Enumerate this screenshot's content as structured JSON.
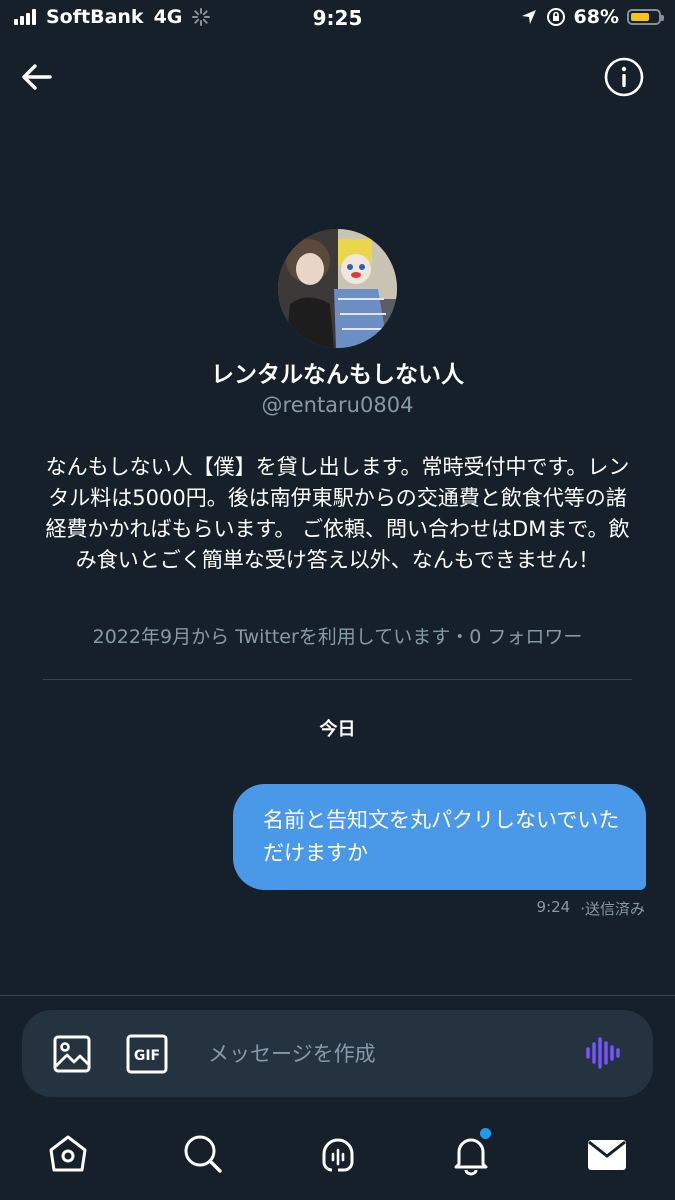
{
  "status_bar": {
    "carrier": "SoftBank",
    "network": "4G",
    "time": "9:25",
    "battery": "68%",
    "battery_level": 0.68
  },
  "header": {
    "back_icon": "back-arrow-icon",
    "info_icon": "info-icon"
  },
  "profile": {
    "name": "レンタルなんもしない人",
    "handle": "@rentaru0804",
    "bio": "なんもしない人【僕】を貸し出します。常時受付中です。レンタル料は5000円。後は南伊東駅からの交通費と飲食代等の諸経費かかればもらいます。 ご依頼、問い合わせはDMまで。飲み食いとごく簡単な受け答え以外、なんもできません！",
    "meta": "2022年9月から Twitterを利用しています・0 フォロワー"
  },
  "conversation": {
    "date_separator": "今日",
    "messages": [
      {
        "text": "名前と告知文を丸パクリしないでいただけますか",
        "time": "9:24",
        "status": "·送信済み"
      }
    ]
  },
  "composer": {
    "placeholder": "メッセージを作成",
    "image_icon": "image-icon",
    "gif_label": "GIF",
    "voice_icon": "voice-record-icon"
  },
  "tab_bar": {
    "items": [
      "home-icon",
      "search-icon",
      "spaces-icon",
      "notifications-icon",
      "messages-icon"
    ],
    "notification_badge": true
  },
  "colors": {
    "background": "#15202b",
    "bubble": "#4a99e9",
    "secondary_text": "#8899a6",
    "accent": "#1d9bf0",
    "voice_accent": "#7856ff"
  }
}
